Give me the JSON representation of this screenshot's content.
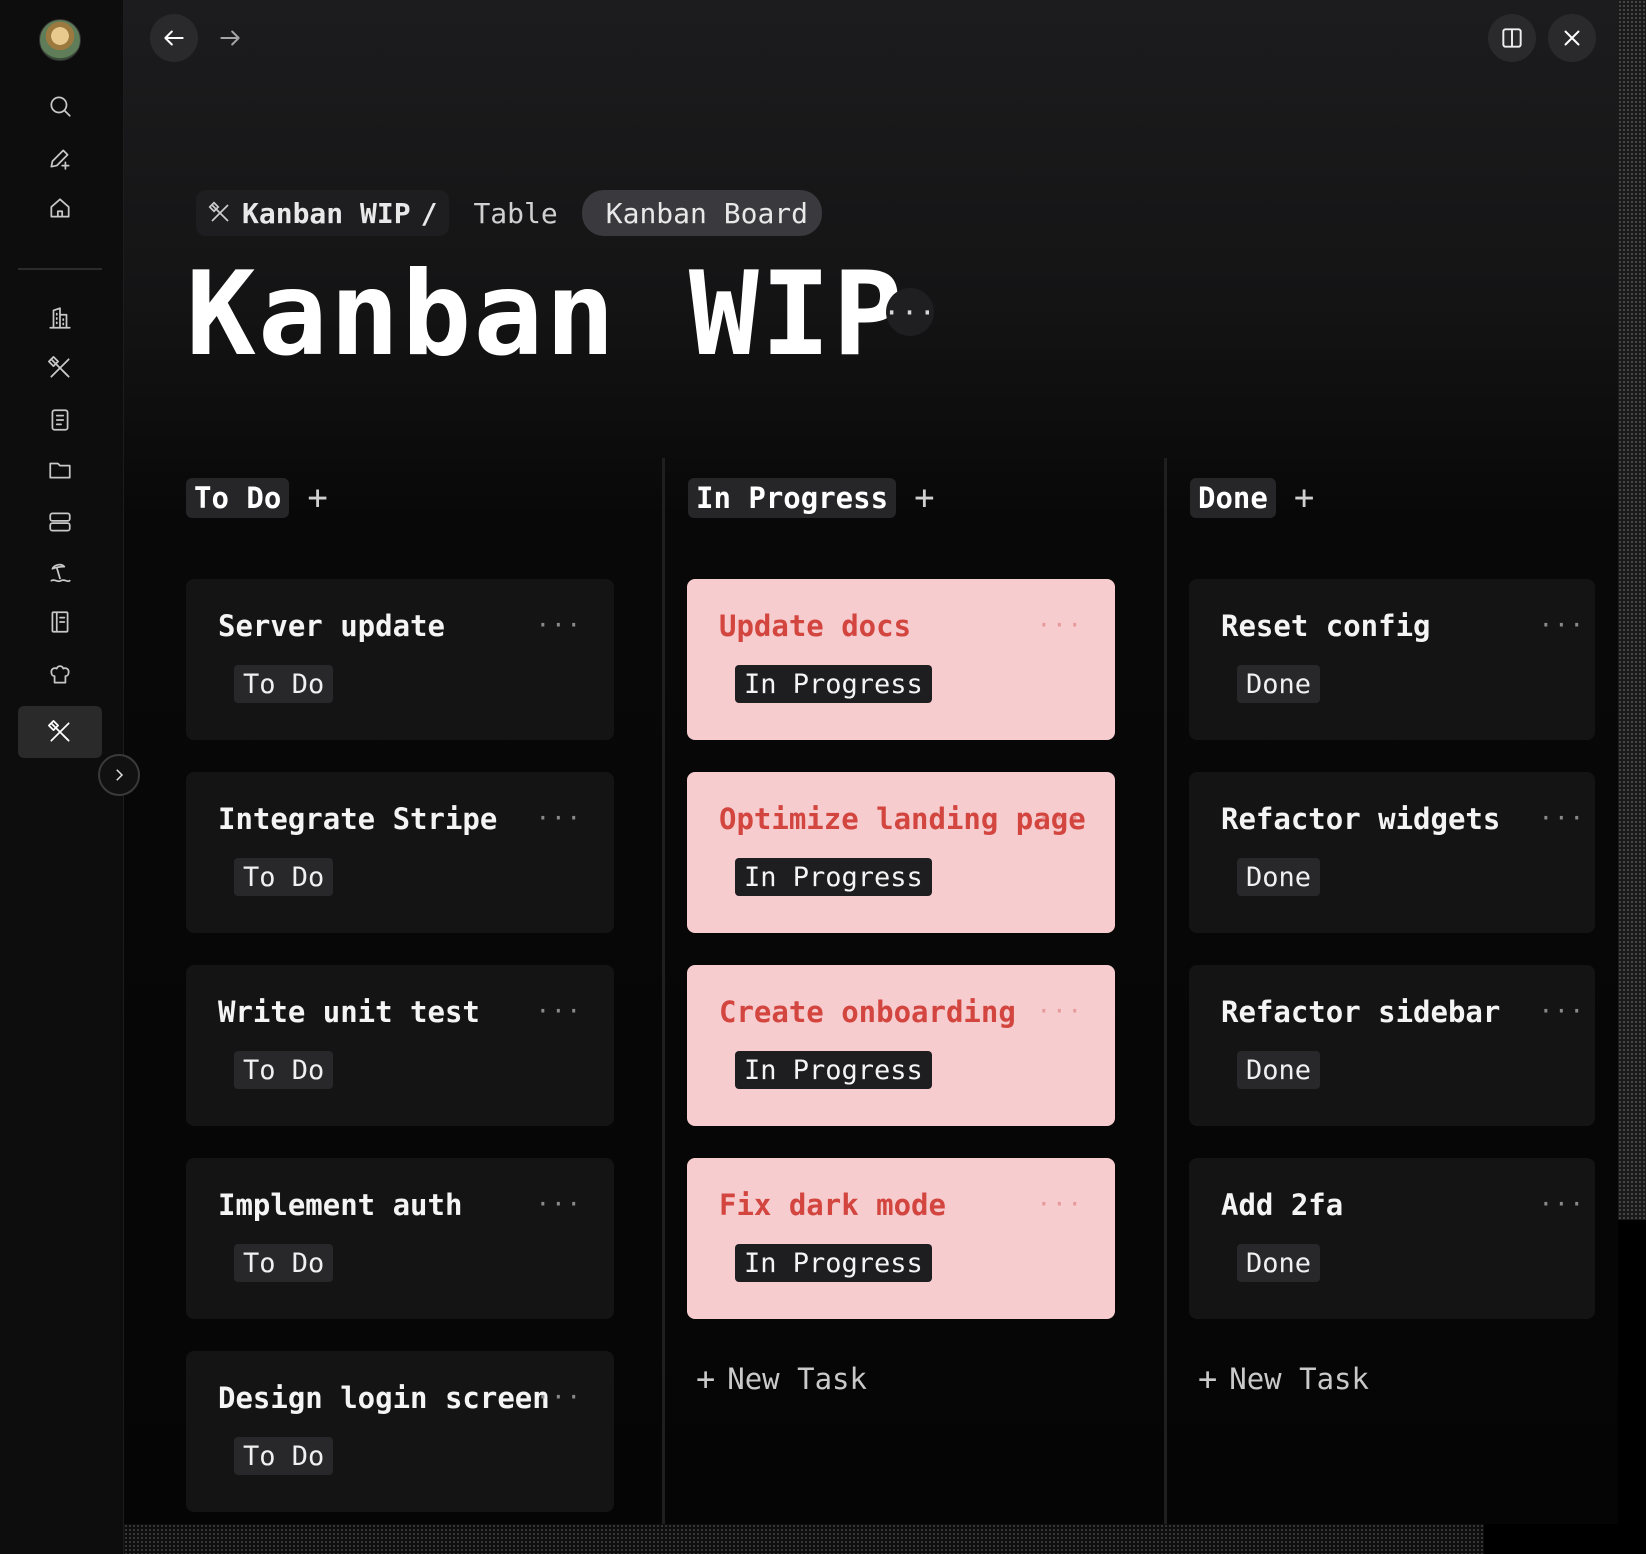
{
  "nav": {
    "back_icon": "arrow-left-icon",
    "forward_icon": "arrow-right-icon",
    "split_icon": "split-view-icon",
    "close_icon": "close-icon"
  },
  "rail": {
    "items": [
      "search-icon",
      "edit-icon",
      "home-icon",
      "building-icon",
      "tools-icon",
      "document-icon",
      "folder-icon",
      "database-icon",
      "beach-icon",
      "book-icon",
      "chef-hat-icon",
      "tools-icon"
    ],
    "active_index": 11
  },
  "breadcrumb": {
    "root": "Kanban WIP",
    "separator": "/",
    "views": [
      "Table",
      "Kanban Board"
    ],
    "active_view": "Kanban Board"
  },
  "page": {
    "title": "Kanban WIP",
    "more": "···"
  },
  "columns": [
    {
      "name": "To Do",
      "add": "+",
      "new_task": "",
      "cards": [
        {
          "title": "Server update",
          "status": "To Do"
        },
        {
          "title": "Integrate Stripe",
          "status": "To Do"
        },
        {
          "title": "Write unit test",
          "status": "To Do"
        },
        {
          "title": "Implement auth",
          "status": "To Do"
        },
        {
          "title": "Design login screen",
          "status": "To Do"
        }
      ]
    },
    {
      "name": "In Progress",
      "add": "+",
      "new_task": "New Task",
      "cards": [
        {
          "title": "Update docs",
          "status": "In Progress"
        },
        {
          "title": "Optimize landing page",
          "status": "In Progress"
        },
        {
          "title": "Create onboarding",
          "status": "In Progress"
        },
        {
          "title": "Fix dark mode",
          "status": "In Progress"
        }
      ]
    },
    {
      "name": "Done",
      "add": "+",
      "new_task": "New Task",
      "cards": [
        {
          "title": "Reset config",
          "status": "Done"
        },
        {
          "title": "Refactor widgets",
          "status": "Done"
        },
        {
          "title": "Refactor sidebar",
          "status": "Done"
        },
        {
          "title": "Add 2fa",
          "status": "Done"
        }
      ]
    }
  ],
  "card_more": "···",
  "new_task_plus": "+",
  "colors": {
    "in_progress_card": "#f7cccf",
    "in_progress_title": "#d3453f"
  }
}
